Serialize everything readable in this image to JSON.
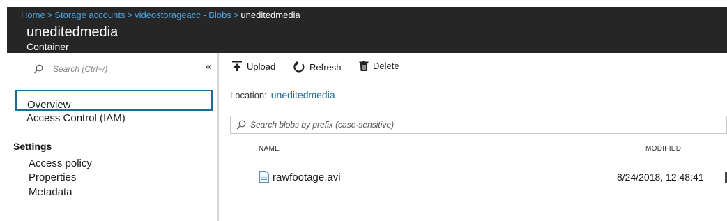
{
  "breadcrumb": {
    "items": [
      "Home",
      "Storage accounts",
      "videostorageacc - Blobs"
    ],
    "separator": ">",
    "current": "uneditedmedia"
  },
  "header": {
    "title": "uneditedmedia",
    "subtitle": "Container"
  },
  "sidebar": {
    "search_placeholder": "Search (Ctrl+/)",
    "collapse_glyph": "«",
    "items": [
      {
        "label": "Overview",
        "selected": true
      },
      {
        "label": "Access Control (IAM)"
      }
    ],
    "settings_heading": "Settings",
    "settings_items": [
      {
        "label": "Access policy"
      },
      {
        "label": "Properties"
      },
      {
        "label": "Metadata"
      }
    ]
  },
  "toolbar": {
    "upload_label": "Upload",
    "refresh_label": "Refresh",
    "delete_label": "Delete"
  },
  "location": {
    "label": "Location:",
    "value": "uneditedmedia"
  },
  "blob_search": {
    "placeholder": "Search blobs by prefix (case-sensitive)"
  },
  "table": {
    "columns": [
      "NAME",
      "MODIFIED"
    ],
    "rows": [
      {
        "name": "rawfootage.avi",
        "modified": "8/24/2018, 12:48:41"
      }
    ]
  },
  "colors": {
    "header_bg": "#262626",
    "breadcrumb_link": "#4aa3df",
    "accent": "#1c6b99"
  }
}
